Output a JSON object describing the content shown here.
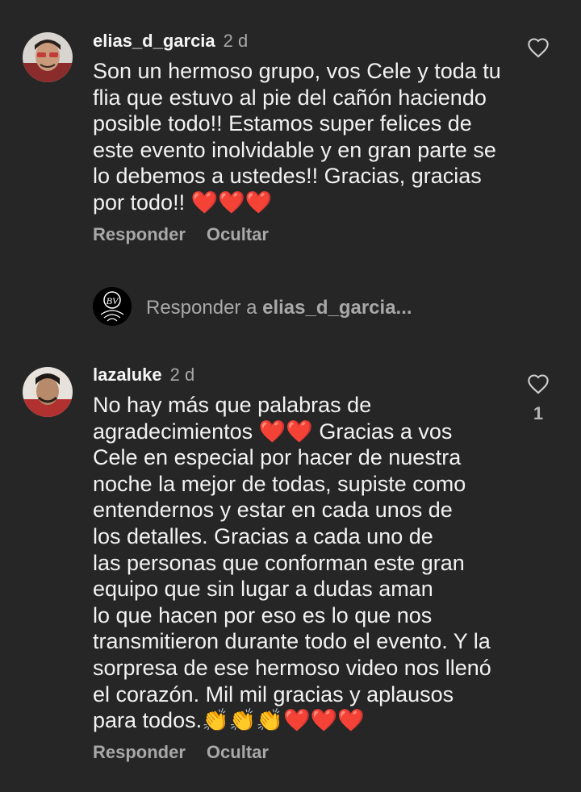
{
  "comments": [
    {
      "username": "elias_d_garcia",
      "time": "2 d",
      "text": "Son un hermoso grupo, vos Cele y toda tu\nflia que estuvo al pie del cañón haciendo\nposible todo!! Estamos super felices de\neste evento inolvidable y en gran parte se\nlo debemos a ustedes!! Gracias, gracias\npor todo!! ❤️❤️❤️",
      "reply_label": "Responder",
      "hide_label": "Ocultar",
      "likes": ""
    },
    {
      "username": "lazaluke",
      "time": "2 d",
      "text": "No hay más que palabras de\nagradecimientos ❤️❤️ Gracias a vos\nCele en especial  por hacer de nuestra\nnoche la mejor de todas, supiste como\nentendernos y estar en cada unos de\nlos detalles. Gracias a cada uno  de\nlas personas que conforman este gran\nequipo que sin lugar a dudas aman\nlo que hacen por eso es lo que nos\ntransmitieron durante todo el evento. Y la\nsorpresa de ese hermoso video nos llenó\nel corazón. Mil mil gracias y aplausos\npara todos.👏👏👏❤️❤️❤️",
      "reply_label": "Responder",
      "hide_label": "Ocultar",
      "likes": "1"
    }
  ],
  "reply_prompt": {
    "prefix": "Responder a ",
    "target": "elias_d_garcia..."
  },
  "icons": {
    "like": "heart-outline-icon",
    "reply_avatar_logo": "BV-logo"
  },
  "colors": {
    "background": "#262626",
    "text": "#f2f2f2",
    "muted": "#a8a8a8"
  }
}
